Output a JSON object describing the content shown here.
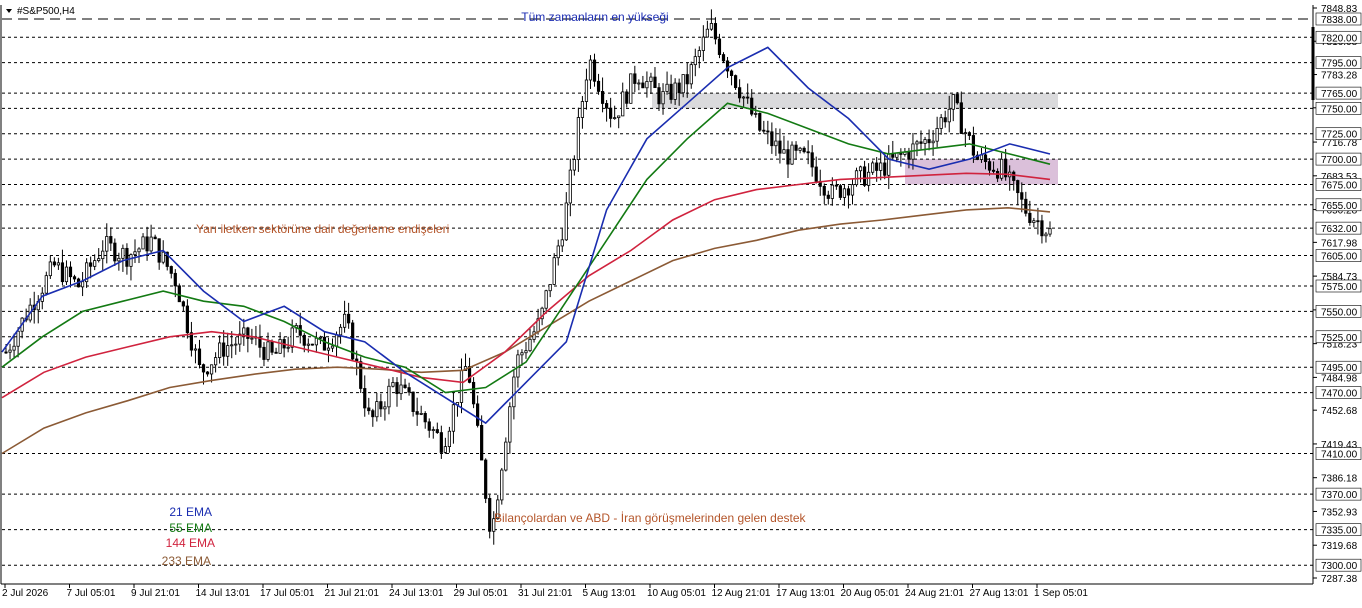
{
  "header": {
    "symbol_label": "#S&P500,H4"
  },
  "colors": {
    "candle": "#000000",
    "ema21": "#1a2db0",
    "ema55": "#137a13",
    "ema144": "#d0233e",
    "ema233": "#8b5a35",
    "zone_gray": "#d6d6d8",
    "zone_pink": "#d7b9d6",
    "annotation_brown": "#b4552a",
    "annotation_blue": "#1c2db2"
  },
  "annotations": {
    "ath_label": "Tüm zamanların en yükseği",
    "semiconductor_note": "Yarı iletken sektörüne dair değerleme endişeleri",
    "earnings_note": "Bilançolardan ve ABD - İran görüşmelerinden gelen destek"
  },
  "legend": {
    "ema21": "21 EMA",
    "ema55": "55 EMA",
    "ema144": "144 EMA",
    "ema233": "233 EMA"
  },
  "chart_data": {
    "type": "candlestick",
    "symbol": "#S&P500",
    "timeframe": "H4",
    "ylim": [
      7287.38,
      7848.83
    ],
    "y_tick_labels": [
      "7848.83",
      "7816.08",
      "7783.28",
      "7750.53",
      "7716.78",
      "7683.53",
      "7650.28",
      "7617.98",
      "7584.73",
      "7551.48",
      "7518.23",
      "7484.98",
      "7452.68",
      "7419.43",
      "7386.18",
      "7352.93",
      "7319.68",
      "7287.38"
    ],
    "level_lines": [
      7838.0,
      7820.0,
      7795.0,
      7765.0,
      7750.0,
      7725.0,
      7700.0,
      7675.0,
      7655.0,
      7632.0,
      7605.0,
      7575.0,
      7550.0,
      7525.0,
      7495.0,
      7470.0,
      7410.0,
      7370.0,
      7335.0,
      7300.0
    ],
    "ath_level": 7838.0,
    "x_labels": [
      "2 Jul 2026",
      "7 Jul 05:01",
      "9 Jul 21:01",
      "14 Jul 13:01",
      "17 Jul 05:01",
      "21 Jul 21:01",
      "24 Jul 13:01",
      "29 Jul 05:01",
      "31 Jul 21:01",
      "5 Aug 13:01",
      "10 Aug 05:01",
      "12 Aug 21:01",
      "17 Aug 13:01",
      "20 Aug 05:01",
      "24 Aug 21:01",
      "27 Aug 13:01",
      "1 Sep 05:01"
    ],
    "zones": [
      {
        "name": "resistance",
        "from": 7750,
        "to": 7765,
        "start_label_index": 10,
        "end_label_index": 16
      },
      {
        "name": "support",
        "from": 7675,
        "to": 7700,
        "start_label_index": 14,
        "end_label_index": 16
      }
    ],
    "ema_anchor_points": {
      "ema21": [
        7510,
        7565,
        7580,
        7600,
        7610,
        7570,
        7540,
        7555,
        7530,
        7520,
        7490,
        7465,
        7440,
        7480,
        7520,
        7650,
        7720,
        7755,
        7790,
        7810,
        7770,
        7740,
        7700,
        7690,
        7700,
        7715,
        7705
      ],
      "ema55": [
        7495,
        7525,
        7550,
        7560,
        7570,
        7560,
        7555,
        7540,
        7520,
        7505,
        7495,
        7470,
        7475,
        7500,
        7560,
        7620,
        7680,
        7720,
        7755,
        7745,
        7730,
        7715,
        7705,
        7710,
        7715,
        7705,
        7695
      ],
      "ema144": [
        7465,
        7490,
        7505,
        7515,
        7525,
        7530,
        7525,
        7515,
        7505,
        7495,
        7485,
        7480,
        7510,
        7550,
        7585,
        7610,
        7640,
        7660,
        7670,
        7675,
        7680,
        7682,
        7684,
        7686,
        7685,
        7680
      ],
      "ema233": [
        7410,
        7435,
        7450,
        7462,
        7475,
        7482,
        7488,
        7493,
        7495,
        7493,
        7490,
        7492,
        7510,
        7535,
        7560,
        7580,
        7600,
        7612,
        7620,
        7630,
        7636,
        7640,
        7645,
        7650,
        7652,
        7648
      ]
    },
    "candle_path_anchors": [
      7510,
      7555,
      7595,
      7575,
      7615,
      7605,
      7620,
      7580,
      7490,
      7515,
      7525,
      7505,
      7530,
      7515,
      7540,
      7440,
      7480,
      7450,
      7420,
      7500,
      7330,
      7500,
      7540,
      7640,
      7800,
      7740,
      7785,
      7760,
      7775,
      7830,
      7780,
      7730,
      7705,
      7700,
      7665,
      7680,
      7690,
      7705,
      7720,
      7755,
      7700,
      7690,
      7650,
      7628
    ],
    "legend_labels": [
      "21 EMA",
      "55 EMA",
      "144 EMA",
      "233 EMA"
    ]
  }
}
